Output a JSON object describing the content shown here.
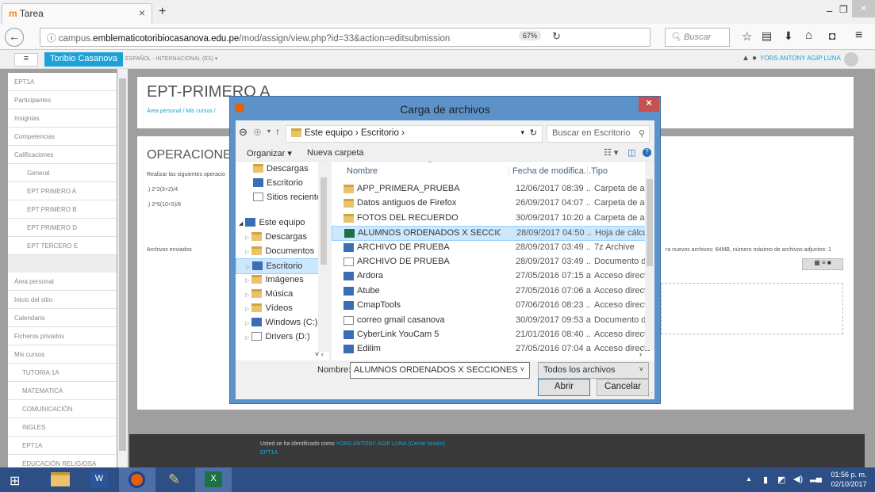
{
  "browser": {
    "tab_title": "Tarea",
    "url_prefix": "campus.",
    "url_domain": "emblematicotoribiocasanova.edu.pe",
    "url_path": "/mod/assign/view.php?id=33&action=editsubmission",
    "zoom": "67%",
    "search_placeholder": "Buscar"
  },
  "moodle": {
    "site_name": "Toribio Casanova",
    "language": "ESPAÑOL - INTERNACIONAL (ES) ▾",
    "user": "YORS ANTONY AGIP LUNA",
    "course_title": "EPT-PRIMERO A",
    "breadcrumb": "Área personal / Mis cursos / ",
    "assignment_title": "OPERACIONES",
    "instructions": "Realizar las siguientes operacio",
    "exercise1": ".) 2*2(3+2)/4",
    "exercise2": ".) 2*5(10+5)/8",
    "submitted_files": "Archivos enviados",
    "limits_text": "ra nuevos archivos: 64MB, número máximo de archivos adjuntos: 1",
    "footer_text": "Usted se ha identificado como ",
    "footer_user": "YORS ANTONY AGIP LUNA",
    "footer_logout": " (Cerrar sesión)",
    "footer_course": "EPT1A"
  },
  "sidebar": {
    "items": [
      "EPT1A",
      "Participantes",
      "Insignias",
      "Competencias",
      "Calificaciones",
      "General",
      "EPT PRIMERO A",
      "EPT PRIMERO B",
      "EPT PRIMERO D",
      "EPT TERCERO E",
      "Área personal",
      "Inicio del sitio",
      "Calendario",
      "Ficheros privados",
      "Mis cursos",
      "TUTORIA 1A",
      "MATEMATICA",
      "COMUNICACIÓN",
      "INGLES",
      "EPT1A",
      "EDUCACIÓN RELIGIOSA"
    ]
  },
  "dialog": {
    "title": "Carga de archivos",
    "close": "×",
    "address": "Este equipo  ›  Escritorio  ›",
    "search_placeholder": "Buscar en Escritorio",
    "organize": "Organizar ▾",
    "new_folder": "Nueva carpeta",
    "tree": [
      "Descargas",
      "Escritorio",
      "Sitios recientes",
      "Este equipo",
      "Descargas",
      "Documentos",
      "Escritorio",
      "Imágenes",
      "Música",
      "Vídeos",
      "Windows (C:)",
      "Drivers (D:)"
    ],
    "columns": [
      "Nombre",
      "Fecha de modifica...",
      "Tipo"
    ],
    "files": [
      {
        "name": "APP_PRIMERA_PRUEBA",
        "date": "12/06/2017 08:39 ...",
        "type": "Carpeta de archiv",
        "icon": "folder"
      },
      {
        "name": "Datos antiguos de Firefox",
        "date": "26/09/2017 04:07 ...",
        "type": "Carpeta de archiv",
        "icon": "folder"
      },
      {
        "name": "FOTOS DEL RECUERDO",
        "date": "30/09/2017 10:20 a...",
        "type": "Carpeta de archiv",
        "icon": "folder"
      },
      {
        "name": "ALUMNOS ORDENADOS X SECCIONES",
        "date": "28/09/2017 04:50 ...",
        "type": "Hoja de cálculo d",
        "icon": "xls"
      },
      {
        "name": "ARCHIVO DE PRUEBA",
        "date": "28/09/2017 03:49 ...",
        "type": "7z Archive",
        "icon": "zz"
      },
      {
        "name": "ARCHIVO DE PRUEBA",
        "date": "28/09/2017 03:49 ...",
        "type": "Documento de M",
        "icon": "doc"
      },
      {
        "name": "Ardora",
        "date": "27/05/2016 07:15 a...",
        "type": "Acceso directo",
        "icon": "lnk"
      },
      {
        "name": "Atube",
        "date": "27/05/2016 07:06 a...",
        "type": "Acceso directo",
        "icon": "lnk"
      },
      {
        "name": "CmapTools",
        "date": "07/06/2016 08:23 ...",
        "type": "Acceso directo",
        "icon": "lnk"
      },
      {
        "name": "correo gmail casanova",
        "date": "30/09/2017 09:53 a...",
        "type": "Documento de te",
        "icon": "doc"
      },
      {
        "name": "CyberLink YouCam 5",
        "date": "21/01/2016 08:40 ...",
        "type": "Acceso directo",
        "icon": "lnk"
      },
      {
        "name": "Edilim",
        "date": "27/05/2016 07:04 a...",
        "type": "Acceso directo",
        "icon": "lnk"
      }
    ],
    "filename_label": "Nombre:",
    "filename_value": "ALUMNOS ORDENADOS X SECCIONES",
    "filter": "Todos los archivos",
    "open": "Abrir",
    "cancel": "Cancelar"
  },
  "taskbar": {
    "time": "01:56 p. m.",
    "date": "02/10/2017"
  },
  "colors": {
    "moodle_blue": "#1ba2d6",
    "dialog_frame": "#5c92c9",
    "taskbar": "#2e4f86",
    "selected_row": "#cce8ff"
  }
}
